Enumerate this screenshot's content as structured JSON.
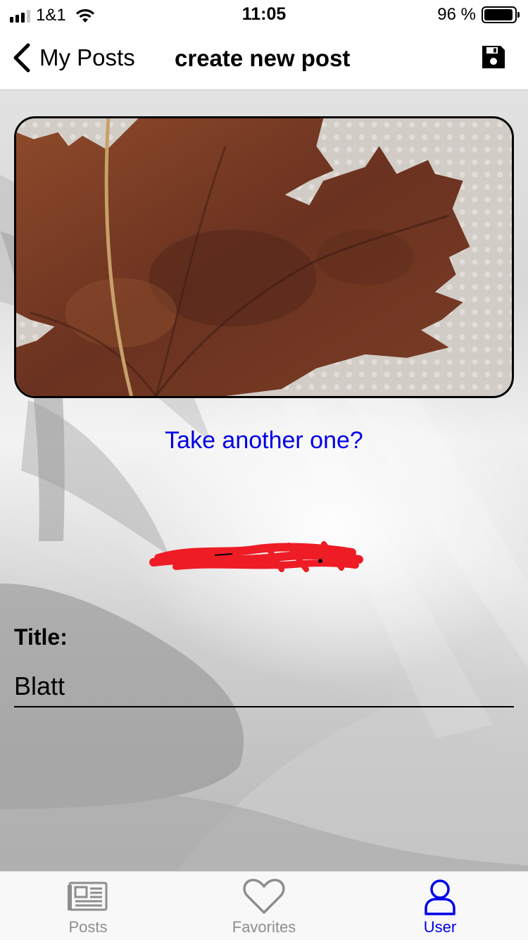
{
  "status_bar": {
    "carrier": "1&1",
    "time": "11:05",
    "battery": "96 %",
    "battery_level": 0.96
  },
  "nav": {
    "back_label": "My Posts",
    "title": "create new post",
    "save_icon": "floppy-disk-icon"
  },
  "photo": {
    "subject": "maple leaf photo"
  },
  "retake_link": "Take another one?",
  "title_field": {
    "label": "Title:",
    "value": "Blatt"
  },
  "tabs": [
    {
      "label": "Posts",
      "icon": "newspaper-icon",
      "active": false
    },
    {
      "label": "Favorites",
      "icon": "heart-icon",
      "active": false
    },
    {
      "label": "User",
      "icon": "user-icon",
      "active": true
    }
  ],
  "colors": {
    "accent": "#0000e6",
    "inactive_tab": "#8e8e8e",
    "redaction": "#ee1c25"
  }
}
